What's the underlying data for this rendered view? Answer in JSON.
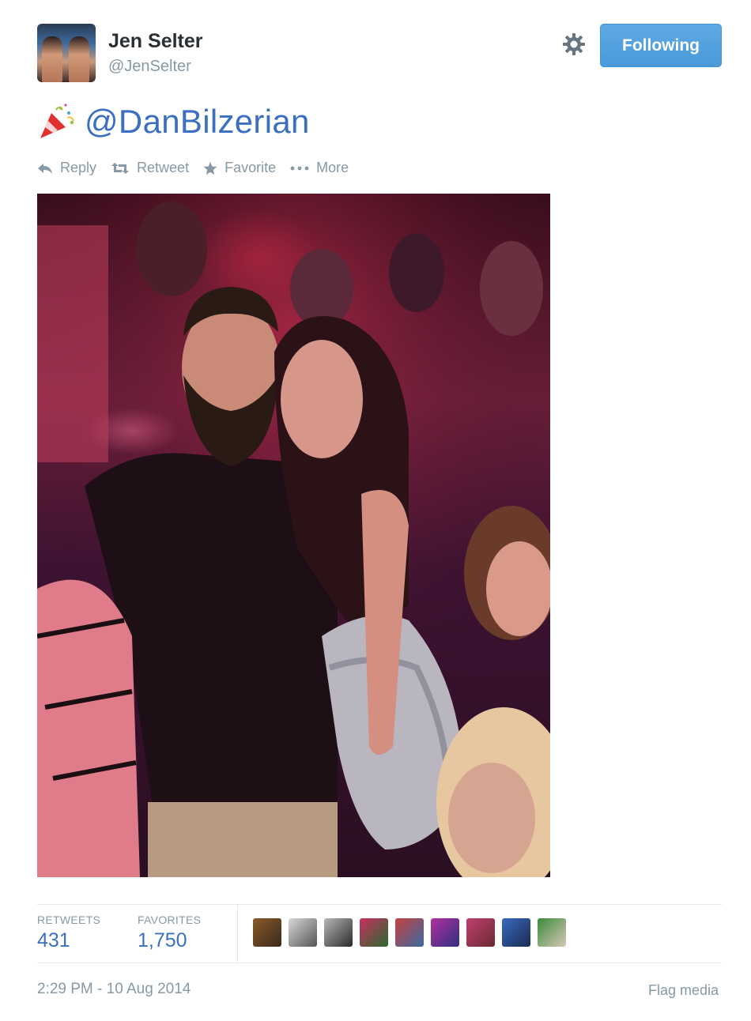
{
  "author": {
    "name": "Jen Selter",
    "handle": "@JenSelter"
  },
  "follow_button": {
    "label": "Following"
  },
  "tweet": {
    "emoji_icon": "party-popper-icon",
    "mention": "@DanBilzerian"
  },
  "actions": {
    "reply": "Reply",
    "retweet": "Retweet",
    "favorite": "Favorite",
    "more": "More"
  },
  "stats": {
    "retweets_label": "RETWEETS",
    "retweets_value": "431",
    "favorites_label": "FAVORITES",
    "favorites_value": "1,750"
  },
  "favoriters_count_shown": 9,
  "timestamp": "2:29 PM - 10 Aug 2014",
  "flag_media": "Flag media",
  "colors": {
    "accent": "#3b6fc1",
    "button_blue": "#55acee",
    "muted": "#8899a6"
  }
}
